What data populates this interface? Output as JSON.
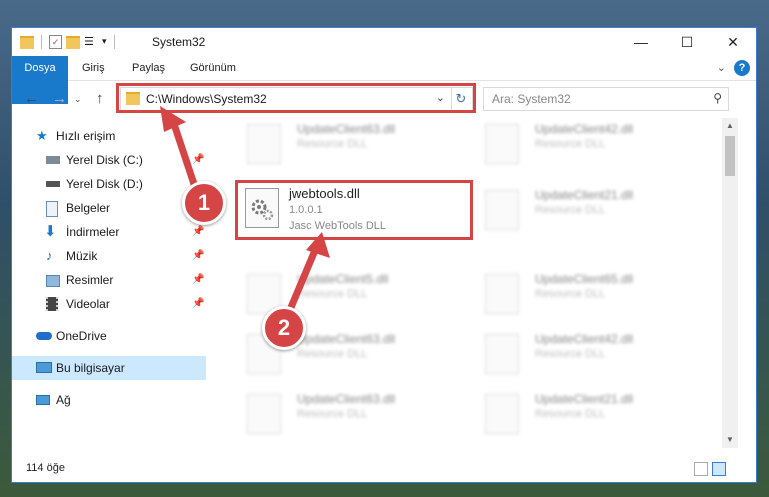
{
  "window": {
    "title": "System32",
    "minimize": "—",
    "maximize": "☐",
    "close": "✕"
  },
  "ribbon": {
    "tabs": [
      "Dosya",
      "Giriş",
      "Paylaş",
      "Görünüm"
    ],
    "help": "?"
  },
  "address": {
    "path": "C:\\Windows\\System32",
    "search_placeholder": "Ara: System32"
  },
  "sidebar": {
    "items": [
      {
        "label": "Hızlı erişim",
        "icon": "star-icon",
        "pinned": false
      },
      {
        "label": "Yerel Disk (C:)",
        "icon": "drive-icon",
        "pinned": true
      },
      {
        "label": "Yerel Disk (D:)",
        "icon": "drive-icon",
        "pinned": false
      },
      {
        "label": "Belgeler",
        "icon": "documents-icon",
        "pinned": true
      },
      {
        "label": "İndirmeler",
        "icon": "downloads-icon",
        "pinned": true
      },
      {
        "label": "Müzik",
        "icon": "music-icon",
        "pinned": true
      },
      {
        "label": "Resimler",
        "icon": "pictures-icon",
        "pinned": true
      },
      {
        "label": "Videolar",
        "icon": "videos-icon",
        "pinned": true
      },
      {
        "label": "OneDrive",
        "icon": "cloud-icon",
        "pinned": false
      },
      {
        "label": "Bu bilgisayar",
        "icon": "computer-icon",
        "pinned": false
      },
      {
        "label": "Ağ",
        "icon": "network-icon",
        "pinned": false
      }
    ]
  },
  "files": {
    "highlighted": {
      "name": "jwebtools.dll",
      "version": "1.0.0.1",
      "description": "Jasc WebTools DLL"
    },
    "left": [
      {
        "name": "UpdateClient63.dll",
        "desc": "Resource DLL"
      },
      {
        "name": "UpdateClient5.dll",
        "desc": "Resource DLL"
      },
      {
        "name": "UpdateClient63.dll",
        "desc": "Resource DLL"
      },
      {
        "name": "UpdateClient63.dll",
        "desc": "Resource DLL"
      }
    ],
    "right": [
      {
        "name": "UpdateClient42.dll",
        "desc": "Resource DLL"
      },
      {
        "name": "UpdateClient21.dll",
        "desc": "Resource DLL"
      },
      {
        "name": "UpdateClient65.dll",
        "desc": "Resource DLL"
      },
      {
        "name": "UpdateClient42.dll",
        "desc": "Resource DLL"
      },
      {
        "name": "UpdateClient21.dll",
        "desc": "Resource DLL"
      }
    ]
  },
  "status": {
    "count": "114 öğe"
  },
  "callouts": [
    "1",
    "2"
  ],
  "colors": {
    "accent": "#1979ca",
    "highlight": "#d64545",
    "selected": "#cce8ff"
  }
}
